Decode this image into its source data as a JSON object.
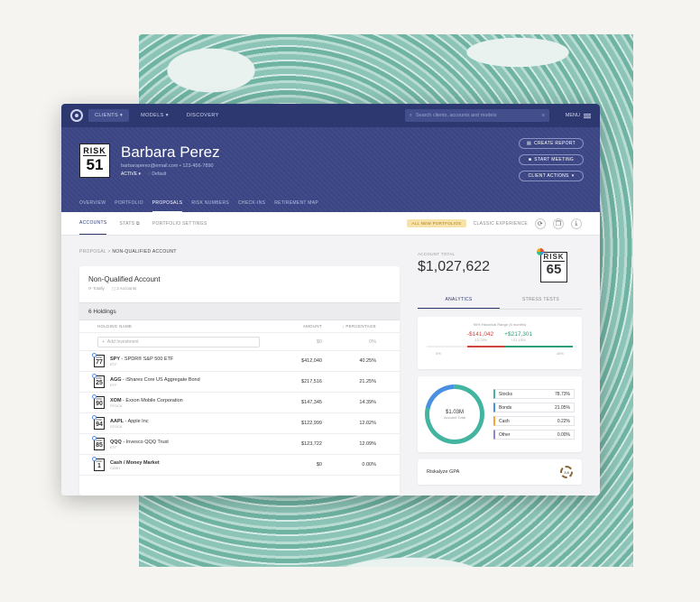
{
  "nav": {
    "clients": "CLIENTS",
    "models": "MODELS",
    "discovery": "DISCOVERY",
    "search_placeholder": "Search clients, accounts and models",
    "menu": "MENU"
  },
  "client": {
    "risk_label": "RISK",
    "risk_score": "51",
    "name": "Barbara Perez",
    "email": "barbaraperez@email.com",
    "phone": "123-456-7890",
    "status": "ACTIVE",
    "default": "Default"
  },
  "header_buttons": [
    "CREATE REPORT",
    "START MEETING",
    "CLIENT ACTIONS"
  ],
  "header_tabs": [
    "OVERVIEW",
    "PORTFOLIO",
    "PROPOSALS",
    "RISK NUMBERS",
    "CHECK-INS",
    "RETIREMENT MAP"
  ],
  "subnav": {
    "accounts": "ACCOUNTS",
    "stats": "STATS",
    "portfolio_settings": "PORTFOLIO SETTINGS",
    "badge": "ALL NEW PORTFOLIOS",
    "classic": "CLASSIC EXPERIENCE"
  },
  "breadcrumb": {
    "root": "PROPOSAL",
    "sep": ">",
    "current": "NON-QUALIFIED ACCOUNT"
  },
  "account": {
    "title": "Non-Qualified Account",
    "meta1": "Totally",
    "meta2": "2 Accounts",
    "holdings": "6 Holdings"
  },
  "table": {
    "col_name": "HOLDING NAME",
    "col_amount": "AMOUNT",
    "col_pct": "PERCENTAGE",
    "add": "Add Investment",
    "add_amt": "$0",
    "add_pct": "0%"
  },
  "holdings": [
    {
      "risk": "77",
      "ticker": "SPY",
      "name": " - SPDR® S&P 500 ETF",
      "type": "ETF",
      "amount": "$412,040",
      "pct": "40.25%"
    },
    {
      "risk": "25",
      "ticker": "AGG",
      "name": " - iShares Core US Aggregate Bond",
      "type": "ETF",
      "amount": "$217,516",
      "pct": "21.25%"
    },
    {
      "risk": "90",
      "ticker": "XOM",
      "name": " - Exxon Mobile Corporation",
      "type": "STOCK",
      "amount": "$147,345",
      "pct": "14.39%"
    },
    {
      "risk": "94",
      "ticker": "AAPL",
      "name": " - Apple Inc",
      "type": "STOCK",
      "amount": "$122,999",
      "pct": "12.02%"
    },
    {
      "risk": "85",
      "ticker": "QQQ",
      "name": " - Invesco QQQ Trust",
      "type": "ETF",
      "amount": "$123,722",
      "pct": "12.09%"
    },
    {
      "risk": "1",
      "ticker": "Cash / Money Market",
      "name": "",
      "type": "CASH",
      "amount": "$0",
      "pct": "0.00%"
    }
  ],
  "summary": {
    "total_label": "ACCOUNT TOTAL",
    "total": "$1,027,622",
    "risk_label": "RISK",
    "risk_score": "65"
  },
  "right_tabs": [
    "ANALYTICS",
    "STRESS TESTS"
  ],
  "range": {
    "label": "95% Historical Range (6 months)",
    "neg": "-$141,042",
    "neg_pct": "-13.73%",
    "pos": "+$217,301",
    "pos_pct": "+21.15%",
    "tick1": "0%",
    "tick2": "45%"
  },
  "allocation": {
    "center_value": "$1.03M",
    "center_label": "Account Total",
    "items": [
      {
        "name": "Stocks",
        "pct": "78.73%",
        "color": "#43b49f"
      },
      {
        "name": "Bonds",
        "pct": "21.05%",
        "color": "#4a90e2"
      },
      {
        "name": "Cash",
        "pct": "0.22%",
        "color": "#f5a623"
      },
      {
        "name": "Other",
        "pct": "0.00%",
        "color": "#9b7fd1"
      }
    ]
  },
  "gpa": {
    "label": "Riskalyze GPA",
    "value": "3.8"
  }
}
